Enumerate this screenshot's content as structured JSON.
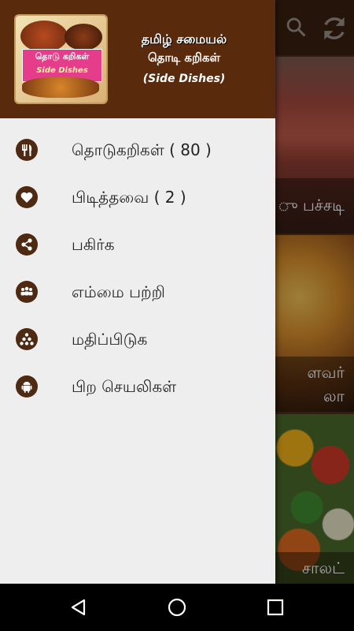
{
  "app": {
    "title_ta": "தமிழ் சமையல்",
    "subtitle_ta": "தொடி கறிகள்",
    "subtitle_en": "(Side Dishes)",
    "logo_badge_ta": "தொடு கறிகள்",
    "logo_badge_en": "Side Dishes"
  },
  "toolbar": {
    "search_icon": "search-icon",
    "refresh_icon": "refresh-icon"
  },
  "background_cards": [
    {
      "caption": "ு பச்சடி"
    },
    {
      "caption_line1": "ளவர்",
      "caption_line2": "லா"
    },
    {
      "caption": "சாலட்"
    }
  ],
  "menu": {
    "items": [
      {
        "label": "தொடுகறிகள் ( 80 )",
        "icon": "cutlery-icon"
      },
      {
        "label": "பிடித்தவை ( 2 )",
        "icon": "heart-icon"
      },
      {
        "label": "பகிர்க",
        "icon": "share-icon"
      },
      {
        "label": "எம்மை பற்றி",
        "icon": "people-icon"
      },
      {
        "label": "மதிப்பிடுக",
        "icon": "rating-icon"
      },
      {
        "label": "பிற செயலிகள்",
        "icon": "android-icon"
      }
    ]
  },
  "colors": {
    "header_bg": "#5a2a0c",
    "icon_bg": "#4e2a12",
    "drawer_bg": "#eeeeee"
  }
}
